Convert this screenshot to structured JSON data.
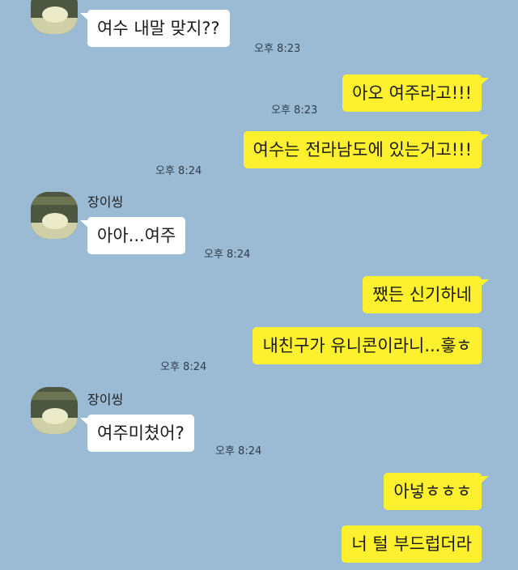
{
  "chat": {
    "partner_name": "장이씽",
    "messages": [
      {
        "side": "in",
        "text": "여수 내말 맞지??",
        "time": "오후 8:23"
      },
      {
        "side": "out",
        "text": "아오 여주라고!!!",
        "time": "오후 8:23"
      },
      {
        "side": "out",
        "text": "여수는 전라남도에 있는거고!!!",
        "time": "오후 8:24"
      },
      {
        "side": "in",
        "text": "아아...여주",
        "time": "오후 8:24"
      },
      {
        "side": "out",
        "text": "쨌든 신기하네",
        "time": ""
      },
      {
        "side": "out",
        "text": "내친구가 유니콘이라니...흫ㅎ",
        "time": "오후 8:24"
      },
      {
        "side": "in",
        "text": "여주미쳤어?",
        "time": "오후 8:24"
      },
      {
        "side": "out",
        "text": "아넣ㅎㅎㅎ",
        "time": ""
      },
      {
        "side": "out",
        "text": "너 털 부드럽더라",
        "time": ""
      }
    ]
  },
  "colors": {
    "background": "#9bbbd4",
    "incoming_bubble": "#ffffff",
    "outgoing_bubble": "#fdf02f"
  }
}
